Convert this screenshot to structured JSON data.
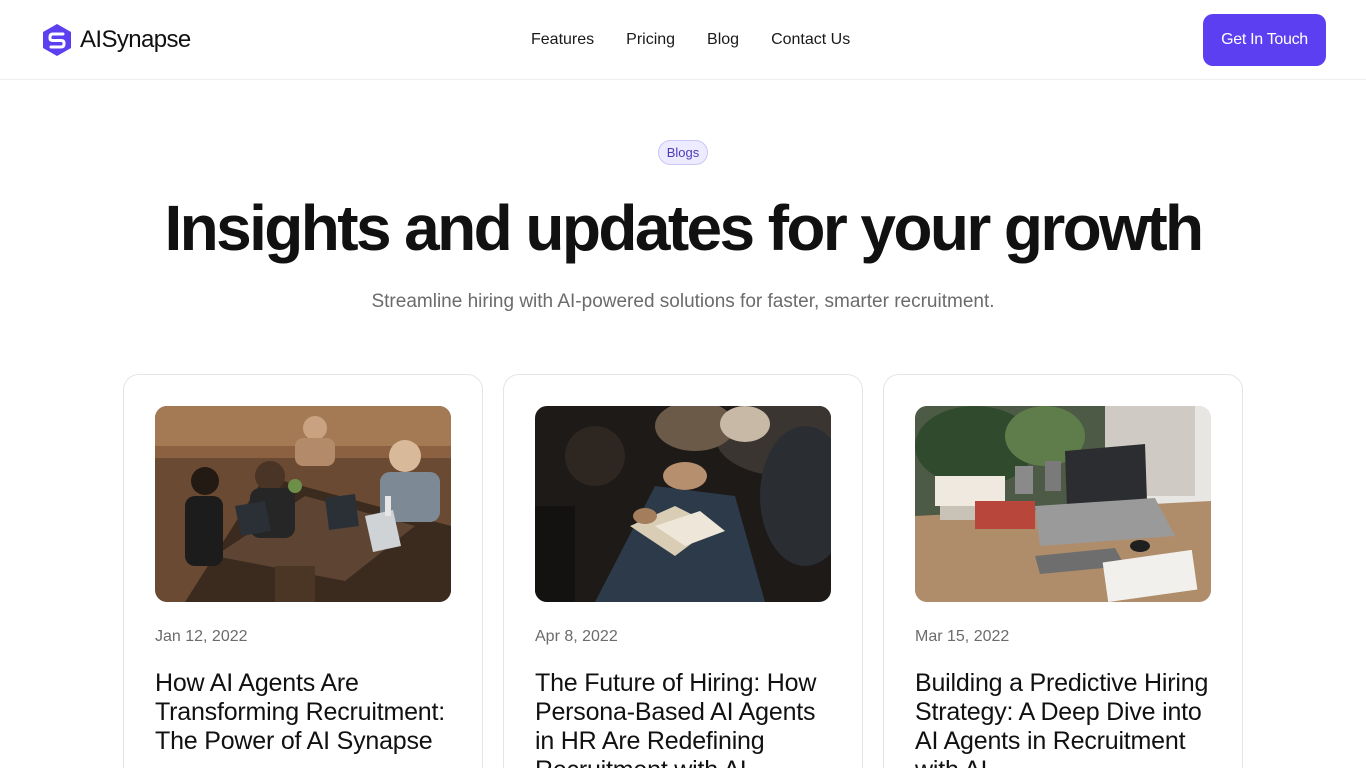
{
  "brand": {
    "name": "AISynapse",
    "color": "#5b3ff0"
  },
  "nav": {
    "items": [
      {
        "label": "Features"
      },
      {
        "label": "Pricing"
      },
      {
        "label": "Blog"
      },
      {
        "label": "Contact Us"
      }
    ],
    "cta_label": "Get In Touch"
  },
  "hero": {
    "badge": "Blogs",
    "title": "Insights and updates for your growth",
    "subtitle": "Streamline hiring with AI-powered solutions for faster, smarter recruitment."
  },
  "posts": [
    {
      "date": "Jan 12, 2022",
      "title": "How AI Agents Are Transforming Recruitment: The Power of AI Synapse",
      "image": "team-working-on-laptops-photo"
    },
    {
      "date": "Apr 8, 2022",
      "title": "The Future of Hiring: How Persona-Based AI Agents in HR Are Redefining Recruitment with AI",
      "image": "audience-with-notebook-photo"
    },
    {
      "date": "Mar 15, 2022",
      "title": "Building a Predictive Hiring Strategy: A Deep Dive into AI Agents in Recruitment with AI",
      "image": "desk-workspace-with-laptop-photo"
    }
  ]
}
